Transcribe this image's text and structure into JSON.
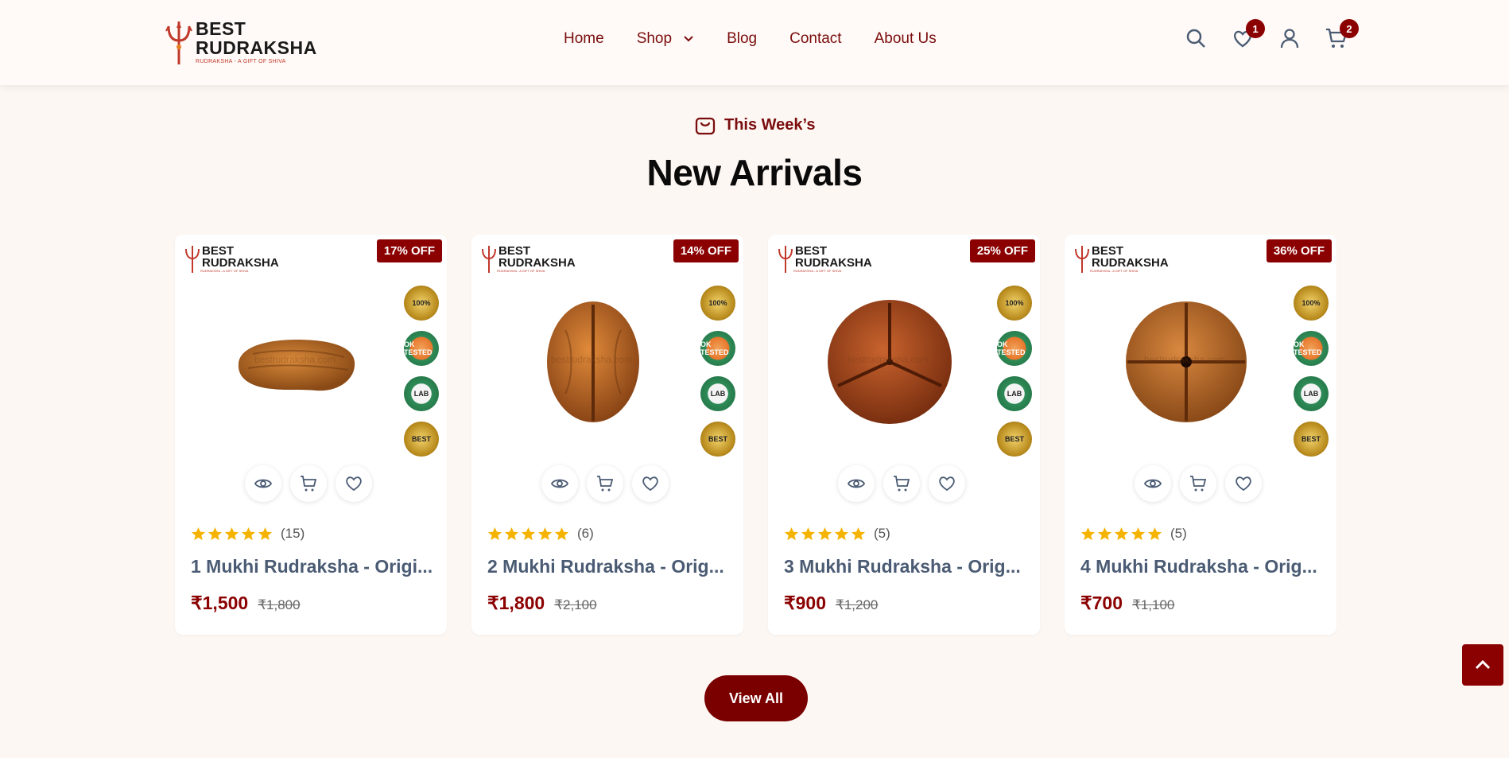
{
  "brand": {
    "line1": "BEST",
    "line2": "RUDRAKSHA",
    "tagline": "RUDRAKSHA - A GIFT OF SHIVA"
  },
  "nav": {
    "items": [
      {
        "label": "Home"
      },
      {
        "label": "Shop"
      },
      {
        "label": "Blog"
      },
      {
        "label": "Contact"
      },
      {
        "label": "About Us"
      }
    ]
  },
  "header_actions": {
    "wishlist_count": "1",
    "cart_count": "2"
  },
  "section": {
    "eyebrow": "This Week’s",
    "title": "New Arrivals"
  },
  "products": [
    {
      "discount": "17% OFF",
      "reviews": "(15)",
      "name": "1 Mukhi Rudraksha - Origi...",
      "price": "₹1,500",
      "old_price": "₹1,800",
      "rating": 5,
      "watermark": "bestrudraksha.com"
    },
    {
      "discount": "14% OFF",
      "reviews": "(6)",
      "name": "2 Mukhi Rudraksha - Orig...",
      "price": "₹1,800",
      "old_price": "₹2,100",
      "rating": 5,
      "watermark": "bestrudraksha.com"
    },
    {
      "discount": "25% OFF",
      "reviews": "(5)",
      "name": "3 Mukhi Rudraksha - Orig...",
      "price": "₹900",
      "old_price": "₹1,200",
      "rating": 5,
      "watermark": "bestrudraksha.com"
    },
    {
      "discount": "36% OFF",
      "reviews": "(5)",
      "name": "4 Mukhi Rudraksha - Orig...",
      "price": "₹700",
      "old_price": "₹1,100",
      "rating": 5,
      "watermark": "bestrudraksha.com"
    }
  ],
  "seals": [
    "100%",
    "OK TESTED",
    "LAB",
    "BEST"
  ],
  "buttons": {
    "view_all": "View All"
  },
  "colors": {
    "brand": "#8b0000",
    "nav_text": "#7a0d0d",
    "star": "#f5b301",
    "product_name": "#4a5b73",
    "background": "#fdf7f3"
  }
}
